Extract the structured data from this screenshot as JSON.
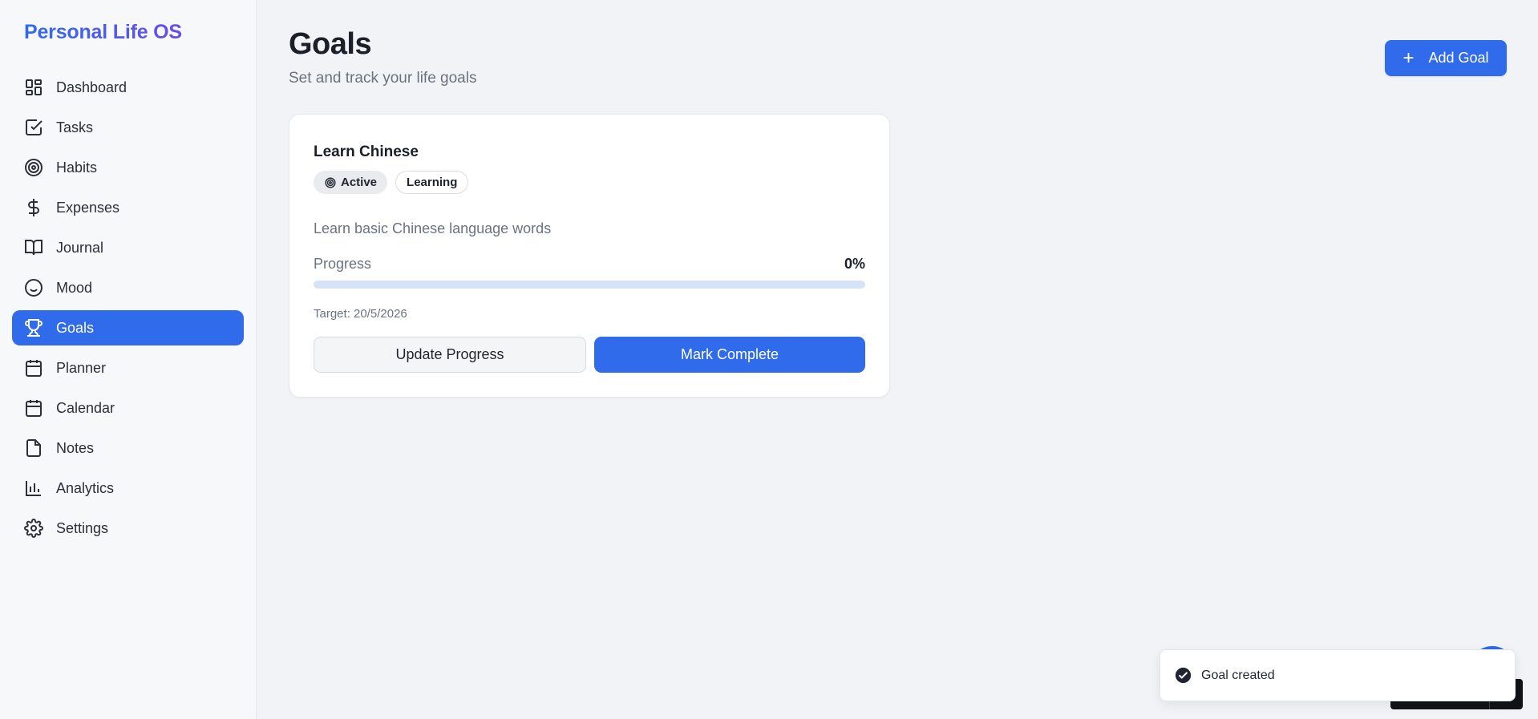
{
  "app": {
    "brand": "Personal Life OS"
  },
  "sidebar": {
    "items": [
      {
        "label": "Dashboard",
        "icon": "dashboard-icon",
        "active": false
      },
      {
        "label": "Tasks",
        "icon": "checkbox-icon",
        "active": false
      },
      {
        "label": "Habits",
        "icon": "target-icon",
        "active": false
      },
      {
        "label": "Expenses",
        "icon": "dollar-icon",
        "active": false
      },
      {
        "label": "Journal",
        "icon": "book-icon",
        "active": false
      },
      {
        "label": "Mood",
        "icon": "smile-icon",
        "active": false
      },
      {
        "label": "Goals",
        "icon": "trophy-icon",
        "active": true
      },
      {
        "label": "Planner",
        "icon": "calendar-grid-icon",
        "active": false
      },
      {
        "label": "Calendar",
        "icon": "calendar-icon",
        "active": false
      },
      {
        "label": "Notes",
        "icon": "file-icon",
        "active": false
      },
      {
        "label": "Analytics",
        "icon": "bar-chart-icon",
        "active": false
      },
      {
        "label": "Settings",
        "icon": "gear-icon",
        "active": false
      }
    ]
  },
  "header": {
    "title": "Goals",
    "subtitle": "Set and track your life goals",
    "add_button_label": "Add Goal"
  },
  "goal_card": {
    "title": "Learn Chinese",
    "status_badge": "Active",
    "category_badge": "Learning",
    "description": "Learn basic Chinese language words",
    "progress_label": "Progress",
    "progress_value": "0%",
    "progress_fraction": 0,
    "target_text": "Target: 20/5/2026",
    "update_button_label": "Update Progress",
    "complete_button_label": "Mark Complete"
  },
  "toast": {
    "message": "Goal created"
  },
  "colors": {
    "accent": "#2f6bea",
    "sidebar_bg": "#f7f8fa",
    "page_bg": "#f1f3f6",
    "progress_track": "#d6e2f8"
  }
}
